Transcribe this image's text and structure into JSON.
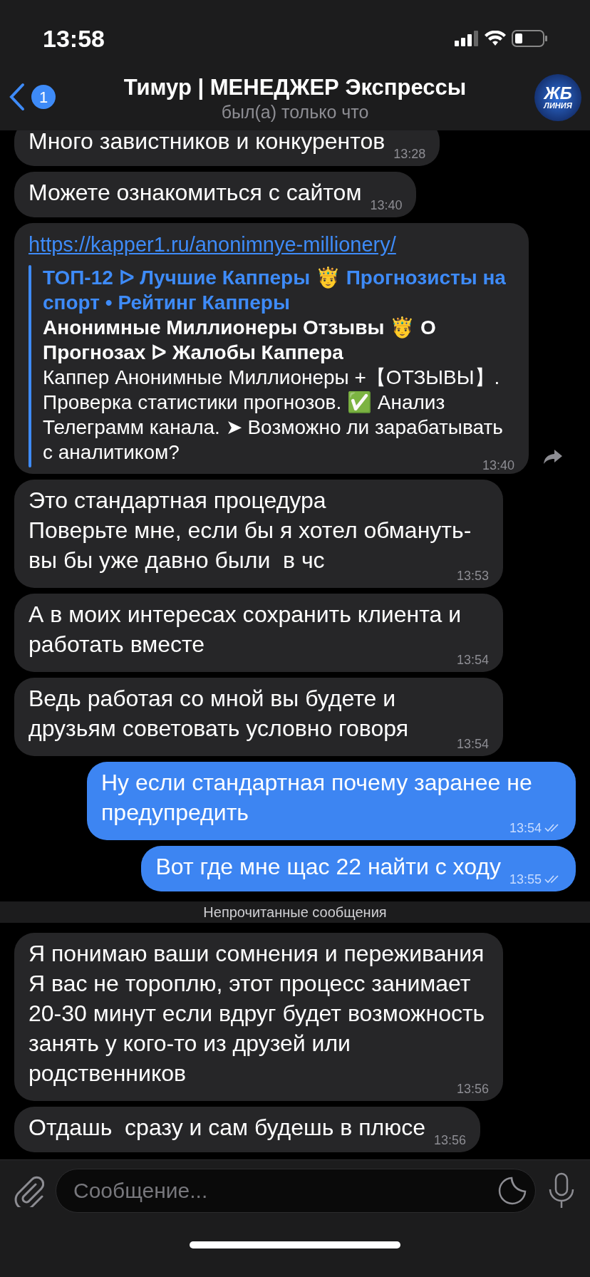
{
  "status_bar": {
    "time": "13:58"
  },
  "header": {
    "unread_count": "1",
    "title": "Тимур | МЕНЕДЖЕР Экспрессы",
    "subtitle": "был(а) только что",
    "avatar": {
      "line1": "ЖБ",
      "line2": "ЛИНИЯ"
    }
  },
  "messages": [
    {
      "kind": "message",
      "outgoing": false,
      "text": "Много завистников и конкурентов",
      "time": "13:28"
    },
    {
      "kind": "message",
      "outgoing": false,
      "text": "Можете ознакомиться с сайтом",
      "time": "13:40"
    },
    {
      "kind": "link",
      "outgoing": false,
      "url": "https://kapper1.ru/anonimnye-millionery/",
      "preview": {
        "site": "ТОП-12 ᐅ Лучшие Капперы 🤴 Прогнозисты на спорт • Рейтинг Капперы",
        "title": "Анонимные Миллионеры Отзывы 🤴 О Прогнозах ᐅ Жалобы Каппера",
        "description": "Каппер Анонимные Миллионеры +【ОТЗЫВЫ】. Проверка статистики прогнозов. ✅ Анализ Телеграмм канала. ➤ Возможно ли зарабатывать с аналитиком?"
      },
      "time": "13:40"
    },
    {
      "kind": "message",
      "outgoing": false,
      "text": "Это стандартная процедура\nПоверьте мне, если бы я хотел обмануть-вы бы уже давно были  в чс",
      "time": "13:53"
    },
    {
      "kind": "message",
      "outgoing": false,
      "text": "А в моих интересах сохранить клиента и работать вместе",
      "time": "13:54"
    },
    {
      "kind": "message",
      "outgoing": false,
      "text": "Ведь работая со мной вы будете и друзьям советовать условно говоря",
      "time": "13:54"
    },
    {
      "kind": "message",
      "outgoing": true,
      "read": true,
      "text": "Ну если стандартная почему заранее не предупредить",
      "time": "13:54"
    },
    {
      "kind": "message",
      "outgoing": true,
      "read": true,
      "text": "Вот где мне щас 22 найти с ходу",
      "time": "13:55"
    },
    {
      "kind": "divider",
      "text": "Непрочитанные сообщения"
    },
    {
      "kind": "message",
      "outgoing": false,
      "text": "Я понимаю ваши сомнения и переживания\nЯ вас не тороплю, этот процесс занимает 20-30 минут если вдруг будет возможность занять у кого-то из друзей или родственников",
      "time": "13:56"
    },
    {
      "kind": "message",
      "outgoing": false,
      "text": "Отдашь  сразу и сам будешь в плюсе",
      "time": "13:56"
    }
  ],
  "composer": {
    "placeholder": "Сообщение..."
  }
}
